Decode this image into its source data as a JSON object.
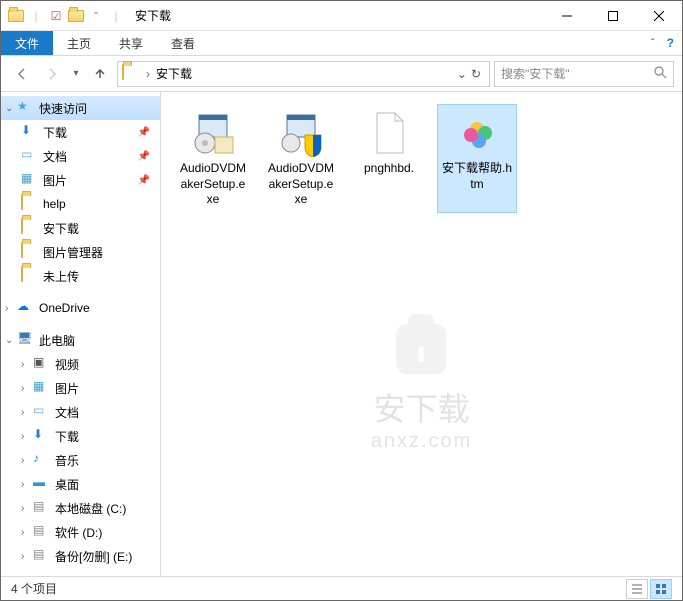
{
  "titlebar": {
    "title": "安下载"
  },
  "ribbon": {
    "file": "文件",
    "home": "主页",
    "share": "共享",
    "view": "查看"
  },
  "nav": {
    "path_sep": "›",
    "path1": "安下载",
    "search_placeholder": "搜索\"安下载\""
  },
  "sidebar": {
    "quick": "快速访问",
    "downloads": "下载",
    "documents": "文档",
    "pictures": "图片",
    "help": "help",
    "anxz": "安下载",
    "picmgr": "图片管理器",
    "noup": "未上传",
    "onedrive": "OneDrive",
    "thispc": "此电脑",
    "videos": "视频",
    "pictures2": "图片",
    "documents2": "文档",
    "downloads2": "下载",
    "music": "音乐",
    "desktop": "桌面",
    "drivec": "本地磁盘 (C:)",
    "drived": "软件 (D:)",
    "drivee": "备份[勿删] (E:)"
  },
  "files": [
    {
      "name": "AudioDVDMakerSetup.exe",
      "type": "exe-installer"
    },
    {
      "name": "AudioDVDMakerSetup.exe",
      "type": "exe-shield"
    },
    {
      "name": "pnghhbd.",
      "type": "blank"
    },
    {
      "name": "安下载帮助.htm",
      "type": "htm"
    }
  ],
  "watermark": {
    "text": "安下载",
    "url": "anxz.com"
  },
  "statusbar": {
    "count": "4 个项目"
  }
}
